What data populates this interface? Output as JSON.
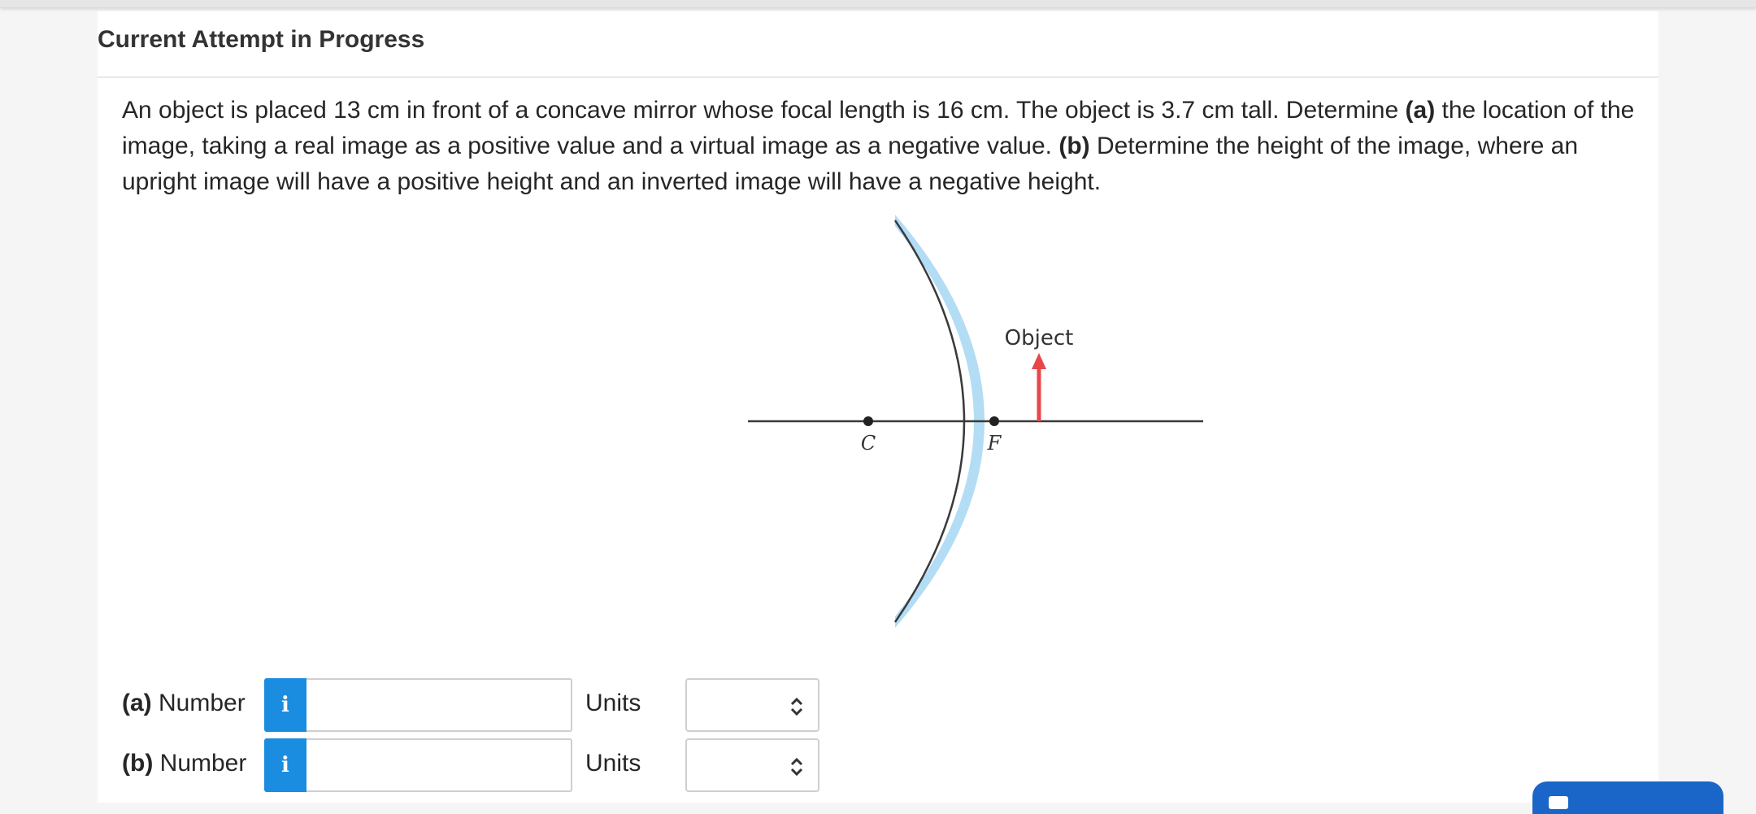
{
  "header": {
    "title": "Current Attempt in Progress"
  },
  "question": {
    "part1": "An object is placed 13 cm in front of a concave mirror whose focal length is 16 cm. The object is 3.7 cm tall. Determine ",
    "a_marker": "(a)",
    "part2": " the location of the image, taking a real image as a positive value and a virtual image as a negative value. ",
    "b_marker": "(b)",
    "part3": " Determine the height of the image, where an upright image will have a positive height and an inverted image will have a negative height."
  },
  "figure": {
    "object_label": "Object",
    "center_label": "C",
    "focal_label": "F",
    "colors": {
      "arrow": "#e8474a",
      "mirror_shade": "#b3dcf5",
      "axis": "#3a3a3a"
    }
  },
  "answers": {
    "a": {
      "marker": "(a)",
      "label": "Number",
      "info_icon": "i",
      "value": "",
      "units_label": "Units",
      "units_value": ""
    },
    "b": {
      "marker": "(b)",
      "label": "Number",
      "info_icon": "i",
      "value": "",
      "units_label": "Units",
      "units_value": ""
    }
  },
  "icons": {
    "info": "info-icon",
    "select": "chevron-updown-icon"
  },
  "colors": {
    "info_button": "#1a8de0",
    "submit_button": "#1a66c8"
  }
}
